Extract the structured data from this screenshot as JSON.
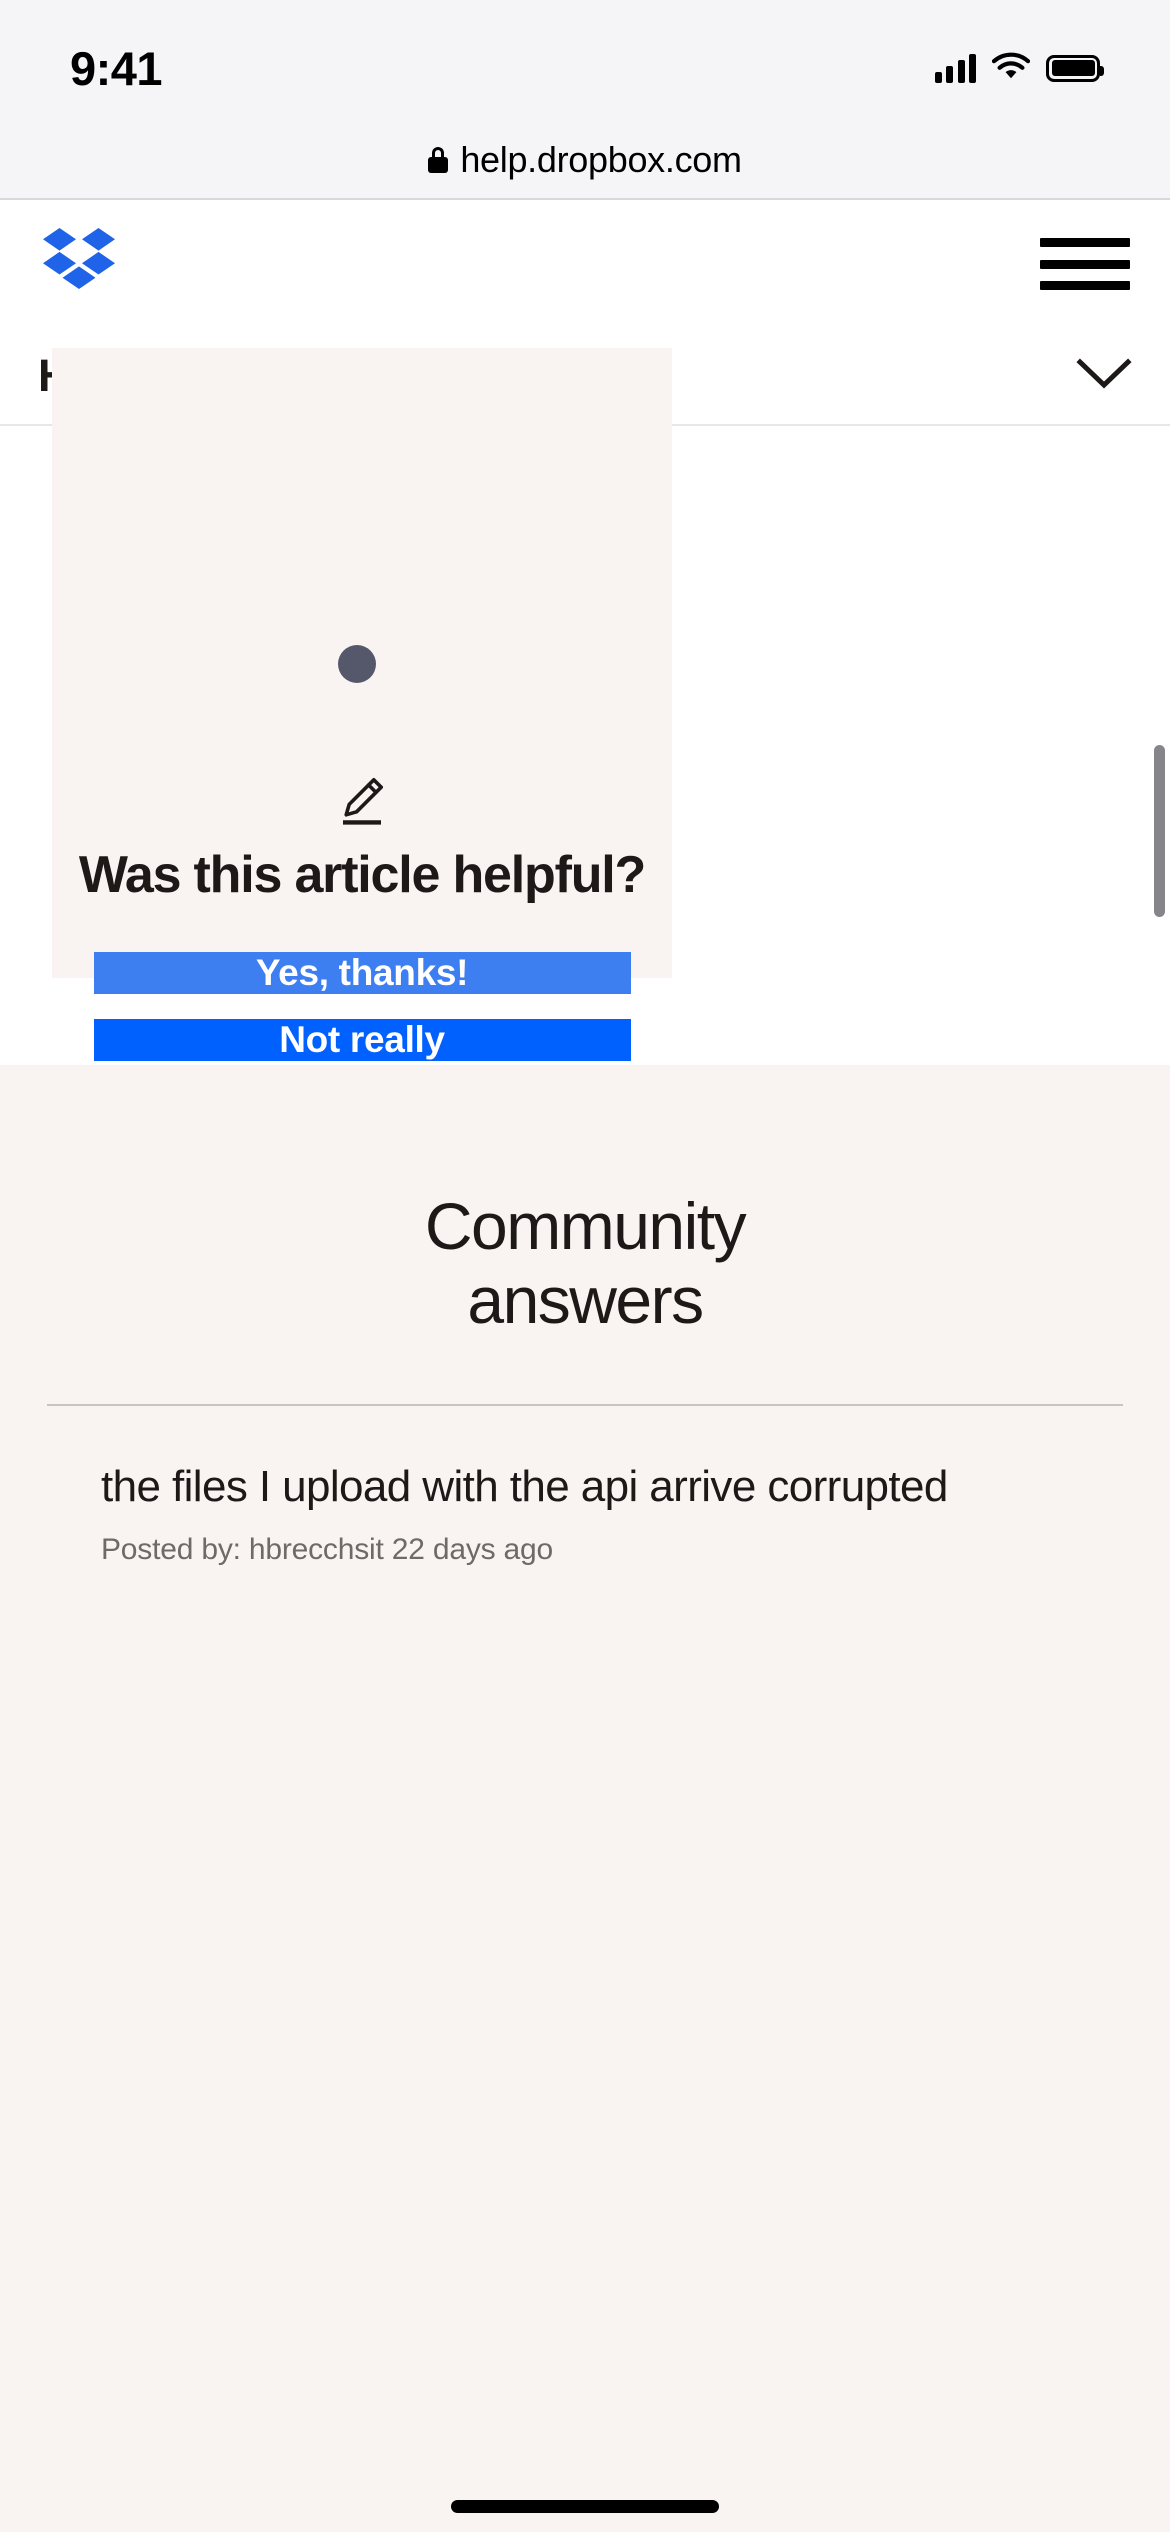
{
  "status_bar": {
    "time": "9:41",
    "cellular_icon": "cellular-signal-icon",
    "wifi_icon": "wifi-icon",
    "battery_icon": "battery-icon"
  },
  "browser": {
    "lock_icon": "lock-icon",
    "url": "help.dropbox.com"
  },
  "site_header": {
    "logo_icon": "dropbox-logo-icon",
    "menu_icon": "hamburger-menu-icon"
  },
  "help_nav": {
    "title": "Help center",
    "chevron_icon": "chevron-down-icon"
  },
  "feedback": {
    "icon": "pencil-icon",
    "question": "Was this article helpful?",
    "yes_label": "Yes, thanks!",
    "no_label": "Not really",
    "yes_color": "#3d7ef0",
    "no_color": "#0061fe",
    "card_background": "#f9f4f2"
  },
  "community": {
    "heading_line1": "Community",
    "heading_line2": "answers",
    "posts": [
      {
        "title": "the files I upload with the api arrive corrupted",
        "meta": "Posted by: hbrecchsit 22 days ago"
      }
    ]
  },
  "cursor": {
    "name": "mouse-cursor-dot"
  },
  "scrollbar": {
    "name": "page-scrollbar"
  }
}
